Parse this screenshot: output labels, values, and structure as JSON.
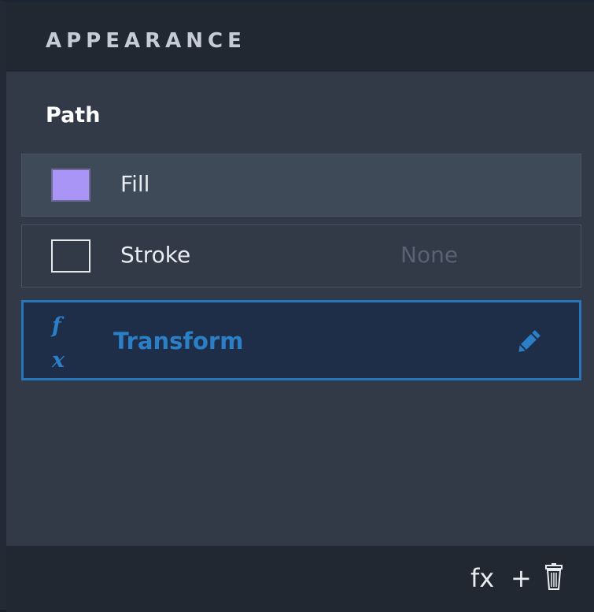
{
  "panel": {
    "title": "APPEARANCE",
    "object_name": "Path"
  },
  "attributes": [
    {
      "label": "Fill",
      "value": "",
      "swatch_color": "#a995f5",
      "icon": "fill-swatch"
    },
    {
      "label": "Stroke",
      "value": "None",
      "swatch_color": "transparent",
      "icon": "stroke-swatch"
    }
  ],
  "effect": {
    "fx_top": "f",
    "fx_bottom": "x",
    "label": "Transform",
    "edit_icon": "pencil-icon",
    "accent_color": "#2a7fc7"
  },
  "footer": {
    "fx_label": "fx",
    "add_label": "+",
    "delete_icon": "trash-icon"
  }
}
